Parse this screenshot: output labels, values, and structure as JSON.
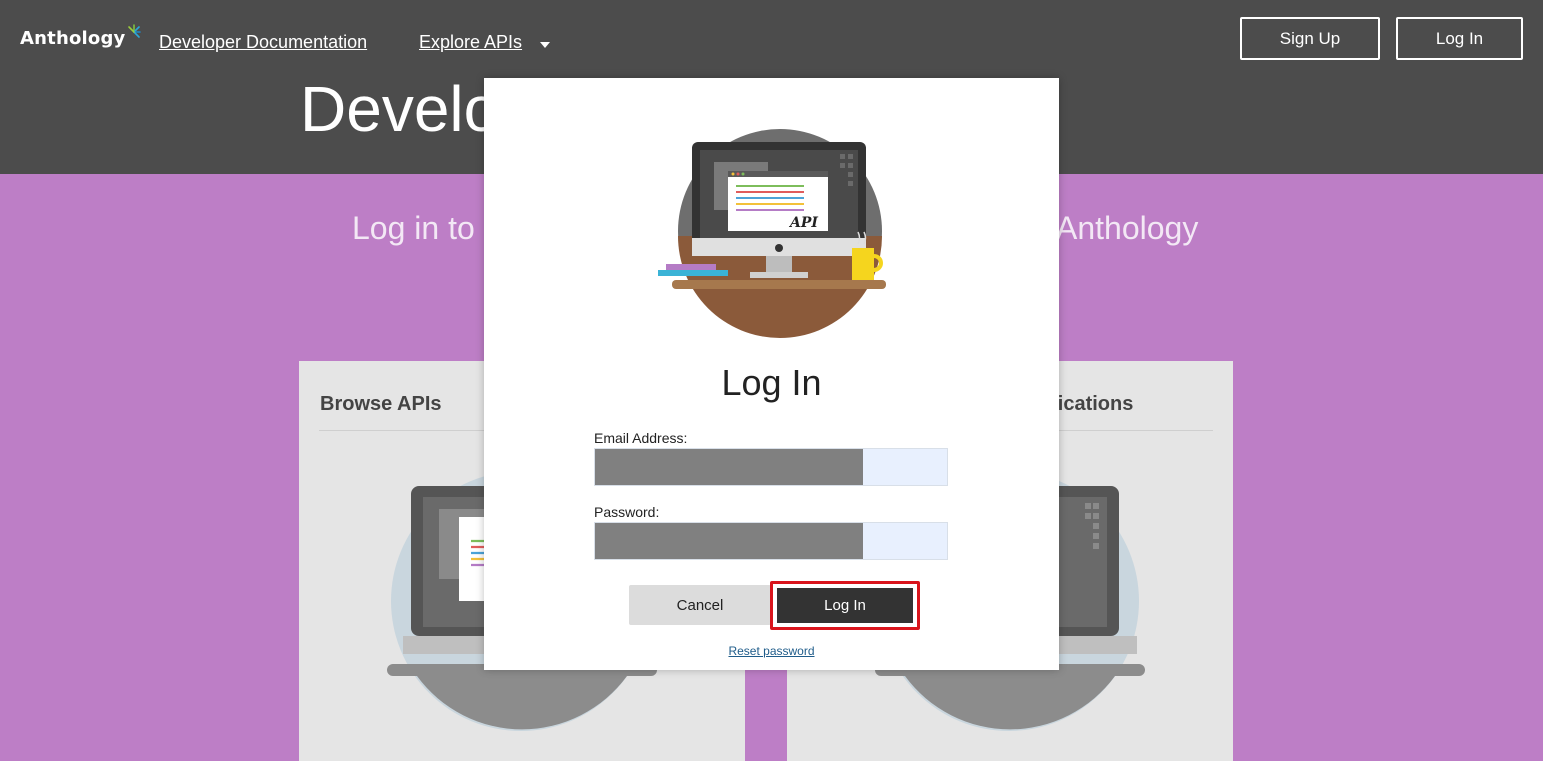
{
  "header": {
    "logo_text": "Anthology",
    "nav": [
      {
        "label": "Developer Documentation"
      },
      {
        "label": "Explore APIs"
      }
    ],
    "signup_label": "Sign Up",
    "login_label": "Log In"
  },
  "hero": {
    "title_visible": "Develo",
    "subtitle_left": "Log in to r",
    "subtitle_right": "Anthology"
  },
  "cards": [
    {
      "title": "Browse APIs"
    },
    {
      "title": "plications"
    }
  ],
  "modal": {
    "illustration_label": "API",
    "title": "Log In",
    "email_label": "Email Address:",
    "email_value": "",
    "password_label": "Password:",
    "password_value": "",
    "cancel_label": "Cancel",
    "login_label": "Log In",
    "reset_label": "Reset password"
  },
  "colors": {
    "header_bg": "#4c4c4c",
    "page_bg": "#bd7ec6",
    "highlight": "#d9141c",
    "primary_button": "#333333"
  }
}
